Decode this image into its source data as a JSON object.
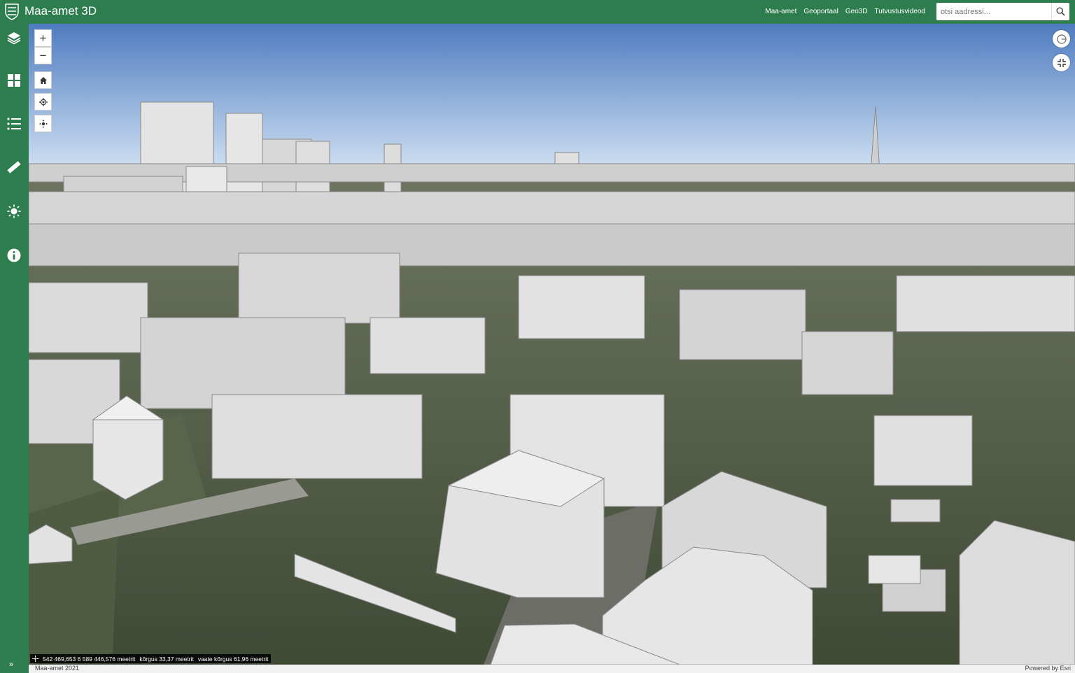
{
  "header": {
    "title": "Maa-amet 3D",
    "links": [
      "Maa-amet",
      "Geoportaal",
      "Geo3D",
      "Tutvustusvideod"
    ],
    "search_placeholder": "otsi aadressi..."
  },
  "sidebar": {
    "items": [
      "layers-icon",
      "basemap-gallery-icon",
      "list-icon",
      "measure-icon",
      "daylight-icon",
      "info-icon"
    ]
  },
  "map_controls": {
    "zoom_in": "+",
    "zoom_out": "−"
  },
  "status": {
    "coordinates": "542 469,653 6 589 446,576 meetrit",
    "elevation": "kõrgus 33,37 meetrit",
    "view_elevation": "vaate kõrgus 61,96 meetrit"
  },
  "footer": {
    "left": "Maa-amet 2021",
    "right": "Powered by Esri"
  },
  "colors": {
    "brand": "#2e7d4f",
    "sky_top": "#4f7cc0",
    "sky_bottom": "#d6e6f5",
    "building": "#dcdcdc",
    "ground": "#4a5a3a"
  }
}
